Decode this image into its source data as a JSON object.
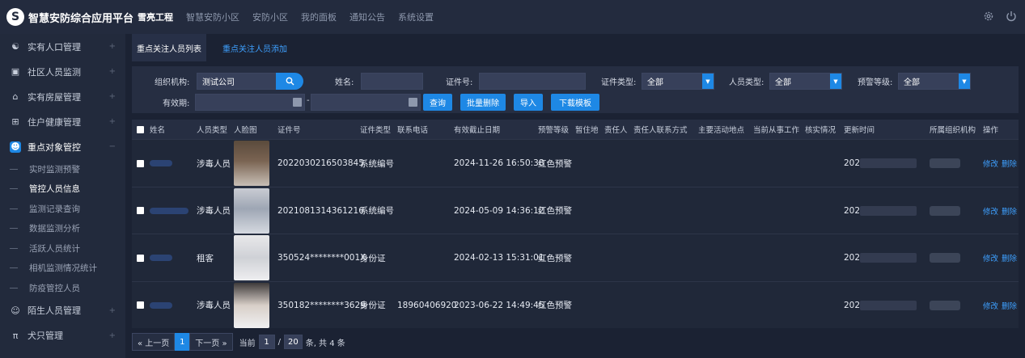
{
  "app": {
    "logo_mark": "S",
    "title": "智慧安防综合应用平台"
  },
  "topnav": [
    "雪亮工程",
    "智慧安防小区",
    "安防小区",
    "我的面板",
    "通知公告",
    "系统设置"
  ],
  "sidebar": {
    "items": [
      {
        "label": "实有人口管理",
        "icon": "person-group-icon"
      },
      {
        "label": "社区人员监测",
        "icon": "monitor-icon"
      },
      {
        "label": "实有房屋管理",
        "icon": "house-icon"
      },
      {
        "label": "住户健康管理",
        "icon": "medical-kit-icon"
      },
      {
        "label": "重点对象管控",
        "icon": "person-icon"
      }
    ],
    "subitems": [
      "实时监测预警",
      "管控人员信息",
      "监测记录查询",
      "数据监测分析",
      "活跃人员统计",
      "相机监测情况统计",
      "防疫管控人员"
    ],
    "bottom_items": [
      {
        "label": "陌生人员管理",
        "icon": "user-icon"
      },
      {
        "label": "犬只管理",
        "icon": "dog-icon"
      }
    ]
  },
  "tabs": [
    "重点关注人员列表",
    "重点关注人员添加"
  ],
  "filter": {
    "org_label": "组织机构:",
    "org_value": "测试公司",
    "name_label": "姓名:",
    "id_label": "证件号:",
    "id_type_label": "证件类型:",
    "id_type_value": "全部",
    "person_type_label": "人员类型:",
    "person_type_value": "全部",
    "warn_level_label": "预警等级:",
    "warn_level_value": "全部",
    "valid_label": "有效期:",
    "range_sep": "-",
    "btn_query": "查询",
    "btn_batch_delete": "批量删除",
    "btn_import": "导入",
    "btn_download": "下载模板"
  },
  "table": {
    "headers": [
      "姓名",
      "人员类型",
      "人脸图",
      "证件号",
      "证件类型",
      "联系电话",
      "有效截止日期",
      "预警等级",
      "暂住地",
      "责任人",
      "责任人联系方式",
      "主要活动地点",
      "当前从事工作",
      "核实情况",
      "更新时间",
      "所属组织机构",
      "操作"
    ],
    "rows": [
      {
        "type": "涉毒人员",
        "id_no": "2022030216503845",
        "id_type": "系统编号",
        "phone": "",
        "expire": "2024-11-26 16:50:38",
        "level": "红色预警",
        "update": "202"
      },
      {
        "type": "涉毒人员",
        "id_no": "2021081314361216",
        "id_type": "系统编号",
        "phone": "",
        "expire": "2024-05-09 14:36:12",
        "level": "红色预警",
        "update": "202"
      },
      {
        "type": "租客",
        "id_no": "350524********001X",
        "id_type": "身份证",
        "phone": "",
        "expire": "2024-02-13 15:31:01",
        "level": "红色预警",
        "update": "202"
      },
      {
        "type": "涉毒人员",
        "id_no": "350182********3629",
        "id_type": "身份证",
        "phone": "18960406920",
        "expire": "2023-06-22 14:49:45",
        "level": "红色预警",
        "update": "202"
      }
    ],
    "op_edit": "修改",
    "op_delete": "删除"
  },
  "pager": {
    "prev": "« 上一页",
    "current": "1",
    "next": "下一页 »",
    "label_current": "当前",
    "page_input": "1",
    "slash": "/",
    "page_size": "20",
    "suffix": "条, 共 4 条"
  }
}
